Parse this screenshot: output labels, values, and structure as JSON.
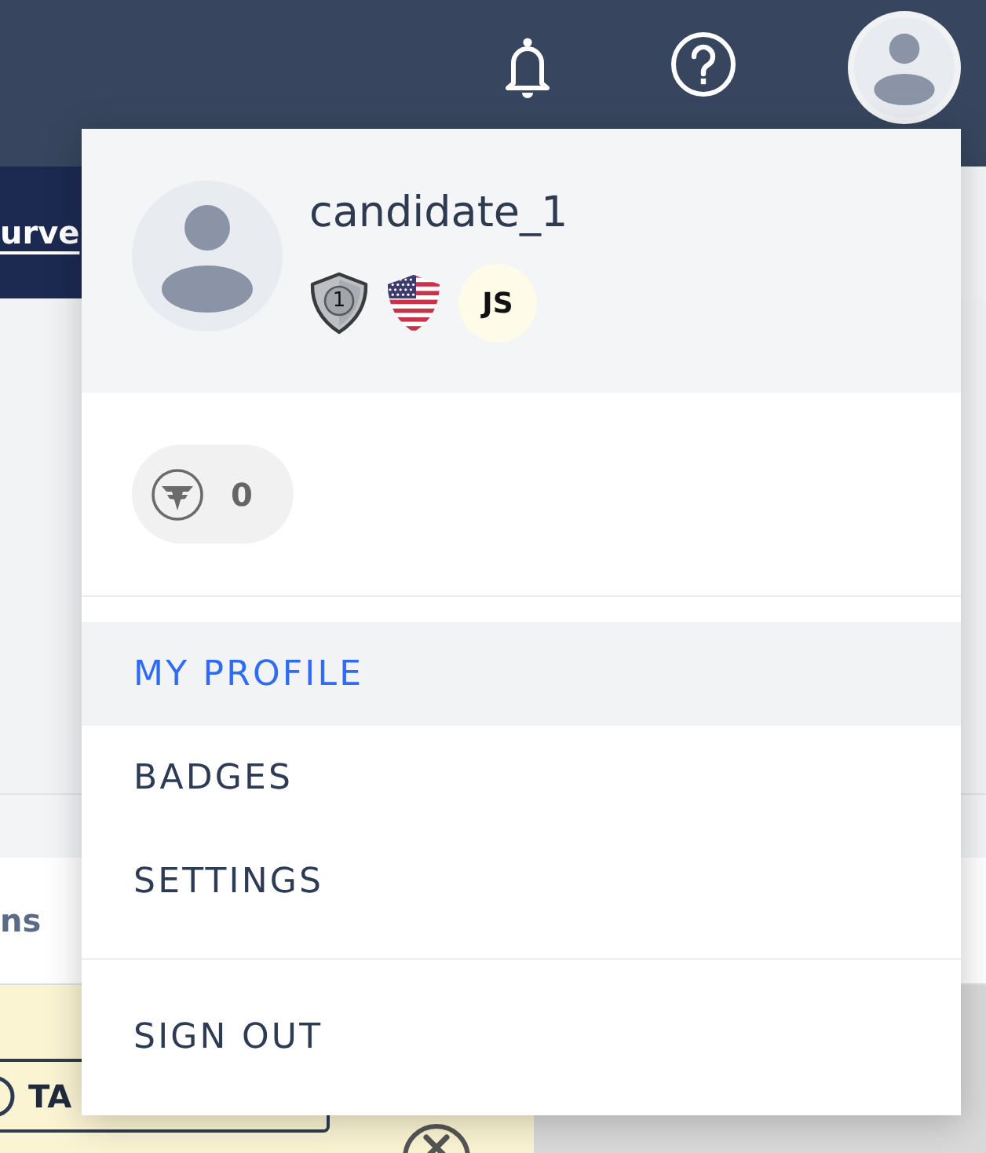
{
  "background_page": {
    "link": "urve",
    "section_title": "ns",
    "button_label": "TA"
  },
  "profile_menu": {
    "username": "candidate_1",
    "badges": [
      {
        "kind": "rank",
        "label": "1"
      },
      {
        "kind": "flag"
      },
      {
        "kind": "initials",
        "label": "JS"
      }
    ],
    "points": "0",
    "items": [
      {
        "label": "MY PROFILE",
        "selected": true
      },
      {
        "label": "BADGES",
        "selected": false
      },
      {
        "label": "SETTINGS",
        "selected": false
      }
    ],
    "footer_items": [
      {
        "label": "SIGN OUT",
        "selected": false
      }
    ]
  }
}
